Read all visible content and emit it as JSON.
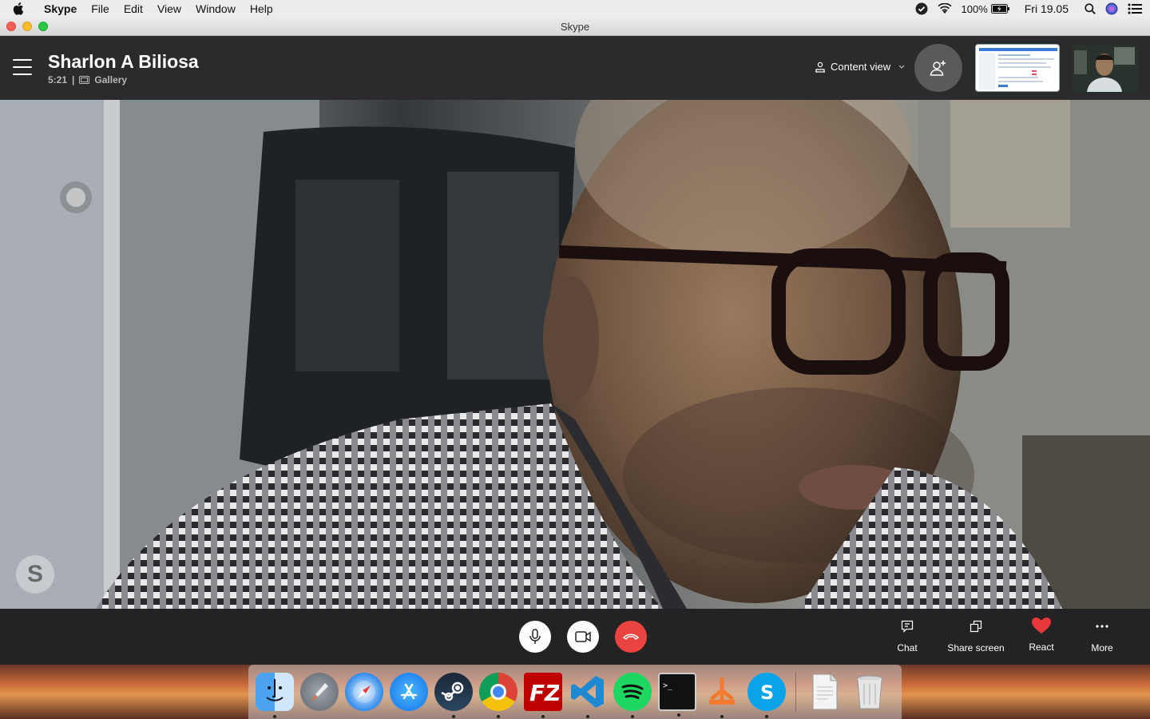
{
  "menubar": {
    "app": "Skype",
    "items": [
      "File",
      "Edit",
      "View",
      "Window",
      "Help"
    ],
    "battery": "100%",
    "clock": "Fri 19.05"
  },
  "window": {
    "title": "Skype"
  },
  "call": {
    "caller_name": "Sharlon A Biliosa",
    "duration": "5:21",
    "separator": "|",
    "view_mode": "Gallery",
    "content_view_label": "Content view"
  },
  "controls": {
    "chat": "Chat",
    "share_screen": "Share screen",
    "react": "React",
    "more": "More"
  },
  "watermark": "S",
  "colors": {
    "end_call": "#ea4340",
    "react_heart": "#e8383a",
    "header_bg": "#2b2b2d",
    "controls_bg": "#232325"
  },
  "dock": {
    "apps": [
      "finder",
      "launchpad",
      "safari",
      "app-store",
      "steam",
      "chrome",
      "filezilla",
      "vscode",
      "spotify",
      "terminal",
      "sourcetree",
      "skype"
    ],
    "others": [
      "document",
      "trash"
    ]
  }
}
